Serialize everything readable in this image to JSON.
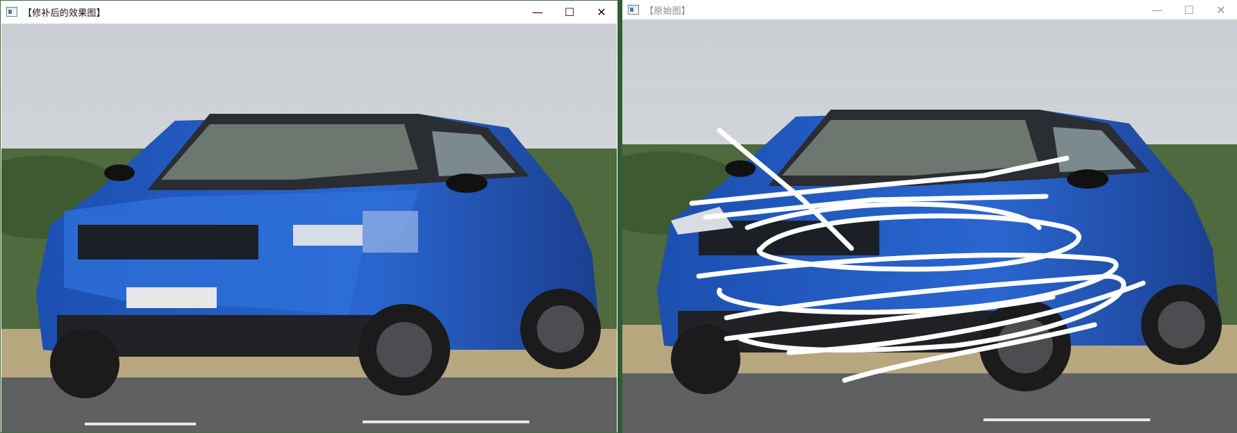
{
  "left_window": {
    "title": "【修补后的效果图】"
  },
  "right_window": {
    "title": "【原始图】"
  },
  "controls": {
    "minimize": "—",
    "maximize": "☐",
    "close": "✕"
  }
}
